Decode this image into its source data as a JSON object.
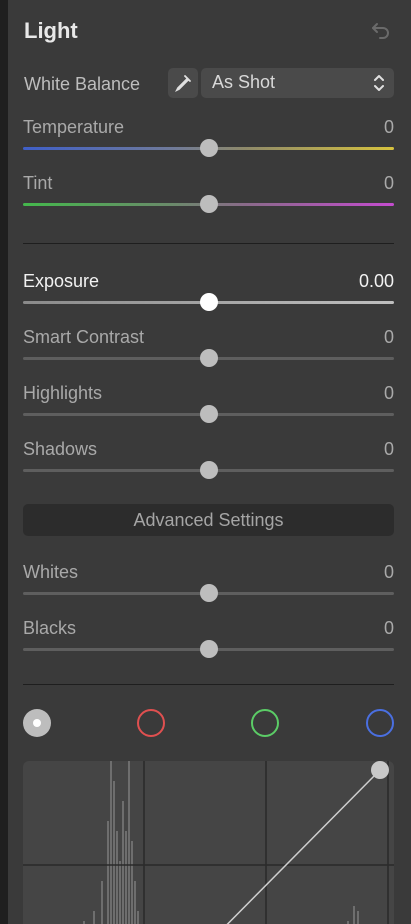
{
  "panel": {
    "title": "Light",
    "reset_icon": "undo-icon"
  },
  "white_balance": {
    "label": "White Balance",
    "picker_icon": "eyedropper-icon",
    "value": "As Shot",
    "chevron_icon": "up-down-chevron-icon"
  },
  "sliders": {
    "temperature": {
      "label": "Temperature",
      "value": "0",
      "position": 0.5
    },
    "tint": {
      "label": "Tint",
      "value": "0",
      "position": 0.5
    },
    "exposure": {
      "label": "Exposure",
      "value": "0.00",
      "position": 0.5
    },
    "smart_contrast": {
      "label": "Smart Contrast",
      "value": "0",
      "position": 0.5
    },
    "highlights": {
      "label": "Highlights",
      "value": "0",
      "position": 0.5
    },
    "shadows": {
      "label": "Shadows",
      "value": "0",
      "position": 0.5
    },
    "whites": {
      "label": "Whites",
      "value": "0",
      "position": 0.5
    },
    "blacks": {
      "label": "Blacks",
      "value": "0",
      "position": 0.5
    }
  },
  "advanced": {
    "label": "Advanced Settings"
  },
  "curve_channels": [
    "rgb",
    "red",
    "green",
    "blue"
  ],
  "colors": {
    "panel_bg": "#3a3a3a",
    "red_channel": "#e05050",
    "green_channel": "#5bcc66",
    "blue_channel": "#4a6fe0"
  }
}
